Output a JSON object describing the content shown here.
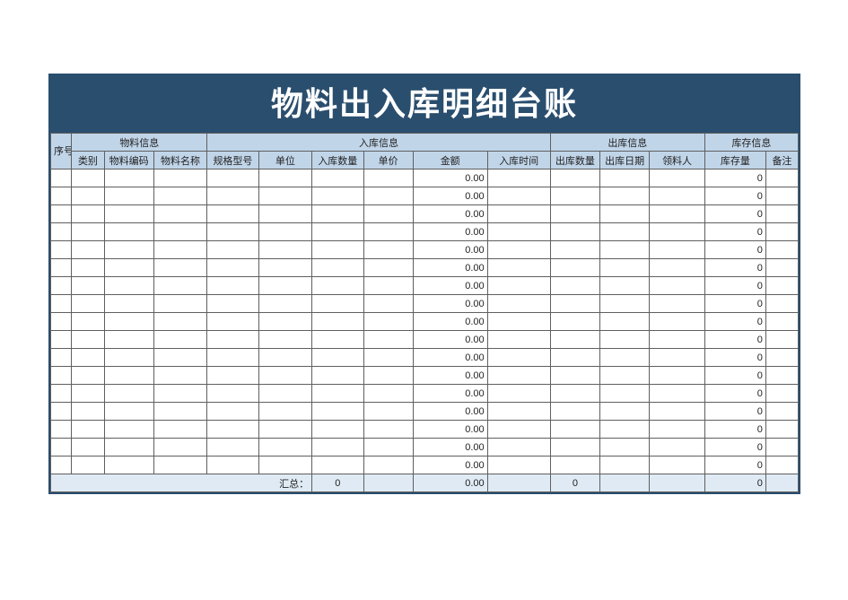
{
  "title": "物料出入库明细台账",
  "headers": {
    "seq": "序号",
    "group_material": "物料信息",
    "group_in": "入库信息",
    "group_out": "出库信息",
    "group_stock": "库存信息",
    "category": "类别",
    "material_code": "物料编码",
    "material_name": "物料名称",
    "spec": "规格型号",
    "unit": "单位",
    "in_qty": "入库数量",
    "price": "单价",
    "amount": "金额",
    "in_time": "入库时间",
    "out_qty": "出库数量",
    "out_date": "出库日期",
    "receiver": "领料人",
    "stock_qty": "库存量",
    "remark": "备注"
  },
  "rows": [
    {
      "seq": "",
      "category": "",
      "code": "",
      "name": "",
      "spec": "",
      "unit": "",
      "in_qty": "",
      "price": "",
      "amount": "0.00",
      "in_time": "",
      "out_qty": "",
      "out_date": "",
      "receiver": "",
      "stock": "0",
      "remark": ""
    },
    {
      "seq": "",
      "category": "",
      "code": "",
      "name": "",
      "spec": "",
      "unit": "",
      "in_qty": "",
      "price": "",
      "amount": "0.00",
      "in_time": "",
      "out_qty": "",
      "out_date": "",
      "receiver": "",
      "stock": "0",
      "remark": ""
    },
    {
      "seq": "",
      "category": "",
      "code": "",
      "name": "",
      "spec": "",
      "unit": "",
      "in_qty": "",
      "price": "",
      "amount": "0.00",
      "in_time": "",
      "out_qty": "",
      "out_date": "",
      "receiver": "",
      "stock": "0",
      "remark": ""
    },
    {
      "seq": "",
      "category": "",
      "code": "",
      "name": "",
      "spec": "",
      "unit": "",
      "in_qty": "",
      "price": "",
      "amount": "0.00",
      "in_time": "",
      "out_qty": "",
      "out_date": "",
      "receiver": "",
      "stock": "0",
      "remark": ""
    },
    {
      "seq": "",
      "category": "",
      "code": "",
      "name": "",
      "spec": "",
      "unit": "",
      "in_qty": "",
      "price": "",
      "amount": "0.00",
      "in_time": "",
      "out_qty": "",
      "out_date": "",
      "receiver": "",
      "stock": "0",
      "remark": ""
    },
    {
      "seq": "",
      "category": "",
      "code": "",
      "name": "",
      "spec": "",
      "unit": "",
      "in_qty": "",
      "price": "",
      "amount": "0.00",
      "in_time": "",
      "out_qty": "",
      "out_date": "",
      "receiver": "",
      "stock": "0",
      "remark": ""
    },
    {
      "seq": "",
      "category": "",
      "code": "",
      "name": "",
      "spec": "",
      "unit": "",
      "in_qty": "",
      "price": "",
      "amount": "0.00",
      "in_time": "",
      "out_qty": "",
      "out_date": "",
      "receiver": "",
      "stock": "0",
      "remark": ""
    },
    {
      "seq": "",
      "category": "",
      "code": "",
      "name": "",
      "spec": "",
      "unit": "",
      "in_qty": "",
      "price": "",
      "amount": "0.00",
      "in_time": "",
      "out_qty": "",
      "out_date": "",
      "receiver": "",
      "stock": "0",
      "remark": ""
    },
    {
      "seq": "",
      "category": "",
      "code": "",
      "name": "",
      "spec": "",
      "unit": "",
      "in_qty": "",
      "price": "",
      "amount": "0.00",
      "in_time": "",
      "out_qty": "",
      "out_date": "",
      "receiver": "",
      "stock": "0",
      "remark": ""
    },
    {
      "seq": "",
      "category": "",
      "code": "",
      "name": "",
      "spec": "",
      "unit": "",
      "in_qty": "",
      "price": "",
      "amount": "0.00",
      "in_time": "",
      "out_qty": "",
      "out_date": "",
      "receiver": "",
      "stock": "0",
      "remark": ""
    },
    {
      "seq": "",
      "category": "",
      "code": "",
      "name": "",
      "spec": "",
      "unit": "",
      "in_qty": "",
      "price": "",
      "amount": "0.00",
      "in_time": "",
      "out_qty": "",
      "out_date": "",
      "receiver": "",
      "stock": "0",
      "remark": ""
    },
    {
      "seq": "",
      "category": "",
      "code": "",
      "name": "",
      "spec": "",
      "unit": "",
      "in_qty": "",
      "price": "",
      "amount": "0.00",
      "in_time": "",
      "out_qty": "",
      "out_date": "",
      "receiver": "",
      "stock": "0",
      "remark": ""
    },
    {
      "seq": "",
      "category": "",
      "code": "",
      "name": "",
      "spec": "",
      "unit": "",
      "in_qty": "",
      "price": "",
      "amount": "0.00",
      "in_time": "",
      "out_qty": "",
      "out_date": "",
      "receiver": "",
      "stock": "0",
      "remark": ""
    },
    {
      "seq": "",
      "category": "",
      "code": "",
      "name": "",
      "spec": "",
      "unit": "",
      "in_qty": "",
      "price": "",
      "amount": "0.00",
      "in_time": "",
      "out_qty": "",
      "out_date": "",
      "receiver": "",
      "stock": "0",
      "remark": ""
    },
    {
      "seq": "",
      "category": "",
      "code": "",
      "name": "",
      "spec": "",
      "unit": "",
      "in_qty": "",
      "price": "",
      "amount": "0.00",
      "in_time": "",
      "out_qty": "",
      "out_date": "",
      "receiver": "",
      "stock": "0",
      "remark": ""
    },
    {
      "seq": "",
      "category": "",
      "code": "",
      "name": "",
      "spec": "",
      "unit": "",
      "in_qty": "",
      "price": "",
      "amount": "0.00",
      "in_time": "",
      "out_qty": "",
      "out_date": "",
      "receiver": "",
      "stock": "0",
      "remark": ""
    },
    {
      "seq": "",
      "category": "",
      "code": "",
      "name": "",
      "spec": "",
      "unit": "",
      "in_qty": "",
      "price": "",
      "amount": "0.00",
      "in_time": "",
      "out_qty": "",
      "out_date": "",
      "receiver": "",
      "stock": "0",
      "remark": ""
    }
  ],
  "summary": {
    "label": "汇总：",
    "in_qty_total": "0",
    "amount_total": "0.00",
    "out_qty_total": "0",
    "stock_total": "0"
  }
}
